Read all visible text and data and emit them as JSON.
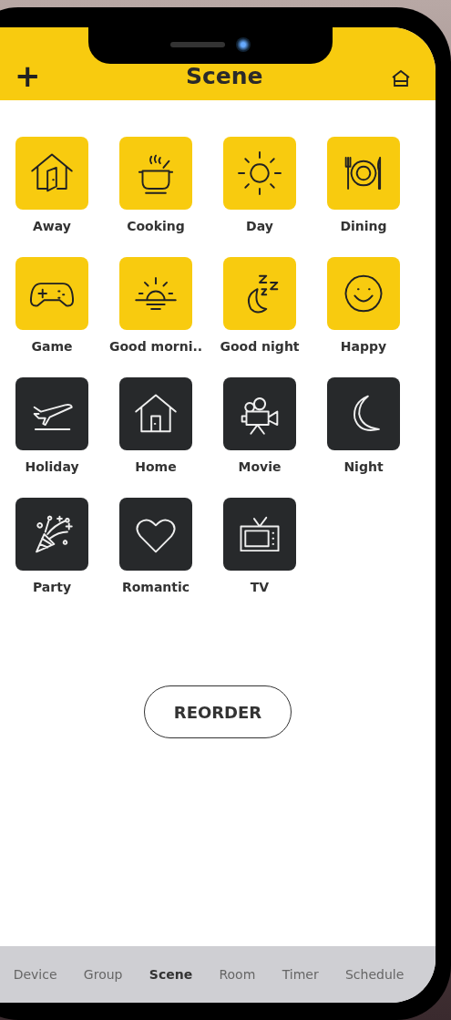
{
  "header": {
    "add_icon": "+",
    "title": "Scene"
  },
  "scenes": [
    {
      "label": "Away",
      "highlighted": true
    },
    {
      "label": "Cooking",
      "highlighted": true
    },
    {
      "label": "Day",
      "highlighted": true
    },
    {
      "label": "Dining",
      "highlighted": true
    },
    {
      "label": "Game",
      "highlighted": true
    },
    {
      "label": "Good morni..",
      "highlighted": true
    },
    {
      "label": "Good night",
      "highlighted": true
    },
    {
      "label": "Happy",
      "highlighted": true
    },
    {
      "label": "Holiday",
      "highlighted": false
    },
    {
      "label": "Home",
      "highlighted": false
    },
    {
      "label": "Movie",
      "highlighted": false
    },
    {
      "label": "Night",
      "highlighted": false
    },
    {
      "label": "Party",
      "highlighted": false
    },
    {
      "label": "Romantic",
      "highlighted": false
    },
    {
      "label": "TV",
      "highlighted": false
    }
  ],
  "reorder_button": "REORDER",
  "tabs": [
    {
      "label": "Device",
      "selected": false
    },
    {
      "label": "Group",
      "selected": false
    },
    {
      "label": "Scene",
      "selected": true
    },
    {
      "label": "Room",
      "selected": false
    },
    {
      "label": "Timer",
      "selected": false
    },
    {
      "label": "Schedule",
      "selected": false
    }
  ]
}
